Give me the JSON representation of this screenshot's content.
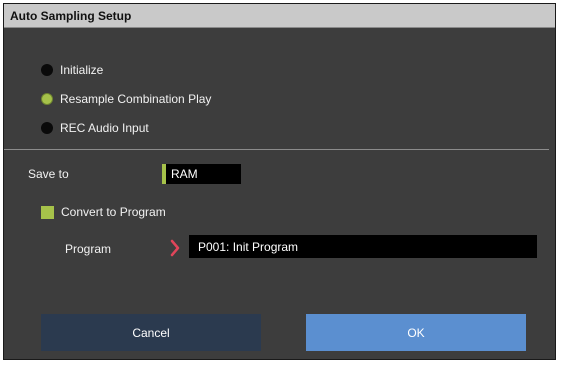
{
  "dialog": {
    "title": "Auto Sampling Setup",
    "mode_options": [
      {
        "label": "Initialize",
        "selected": false
      },
      {
        "label": "Resample Combination Play",
        "selected": true
      },
      {
        "label": "REC Audio Input",
        "selected": false
      }
    ],
    "save_to": {
      "label": "Save to",
      "value": "RAM"
    },
    "convert_to_program": {
      "label": "Convert to Program",
      "checked": true
    },
    "program": {
      "label": "Program",
      "value": "P001: Init Program"
    },
    "buttons": {
      "cancel": "Cancel",
      "ok": "OK"
    },
    "colors": {
      "accent": "#a6c24a",
      "ok_button": "#5b8fd0",
      "cancel_button": "#2b3a4f",
      "chevron": "#e0455a"
    }
  }
}
